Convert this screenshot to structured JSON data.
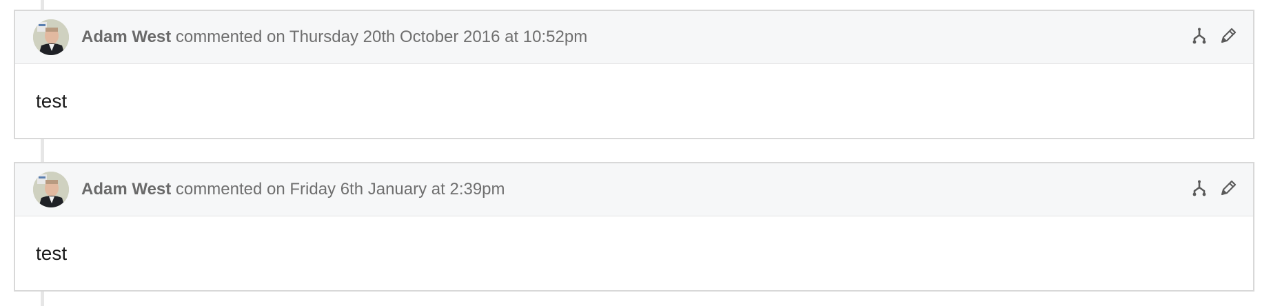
{
  "comments": [
    {
      "author": "Adam West",
      "action_text": " commented on Thursday 20th October 2016 at 10:52pm",
      "body": "test",
      "icons": [
        "fork-icon",
        "pencil-icon"
      ]
    },
    {
      "author": "Adam West",
      "action_text": " commented on Friday 6th January at 2:39pm",
      "body": "test",
      "icons": [
        "fork-icon",
        "pencil-icon"
      ]
    }
  ],
  "colors": {
    "header_bg": "#f6f7f8",
    "border": "#d8d8d8",
    "meta_text": "#6f6f6f",
    "timeline": "#e6e6e6"
  }
}
